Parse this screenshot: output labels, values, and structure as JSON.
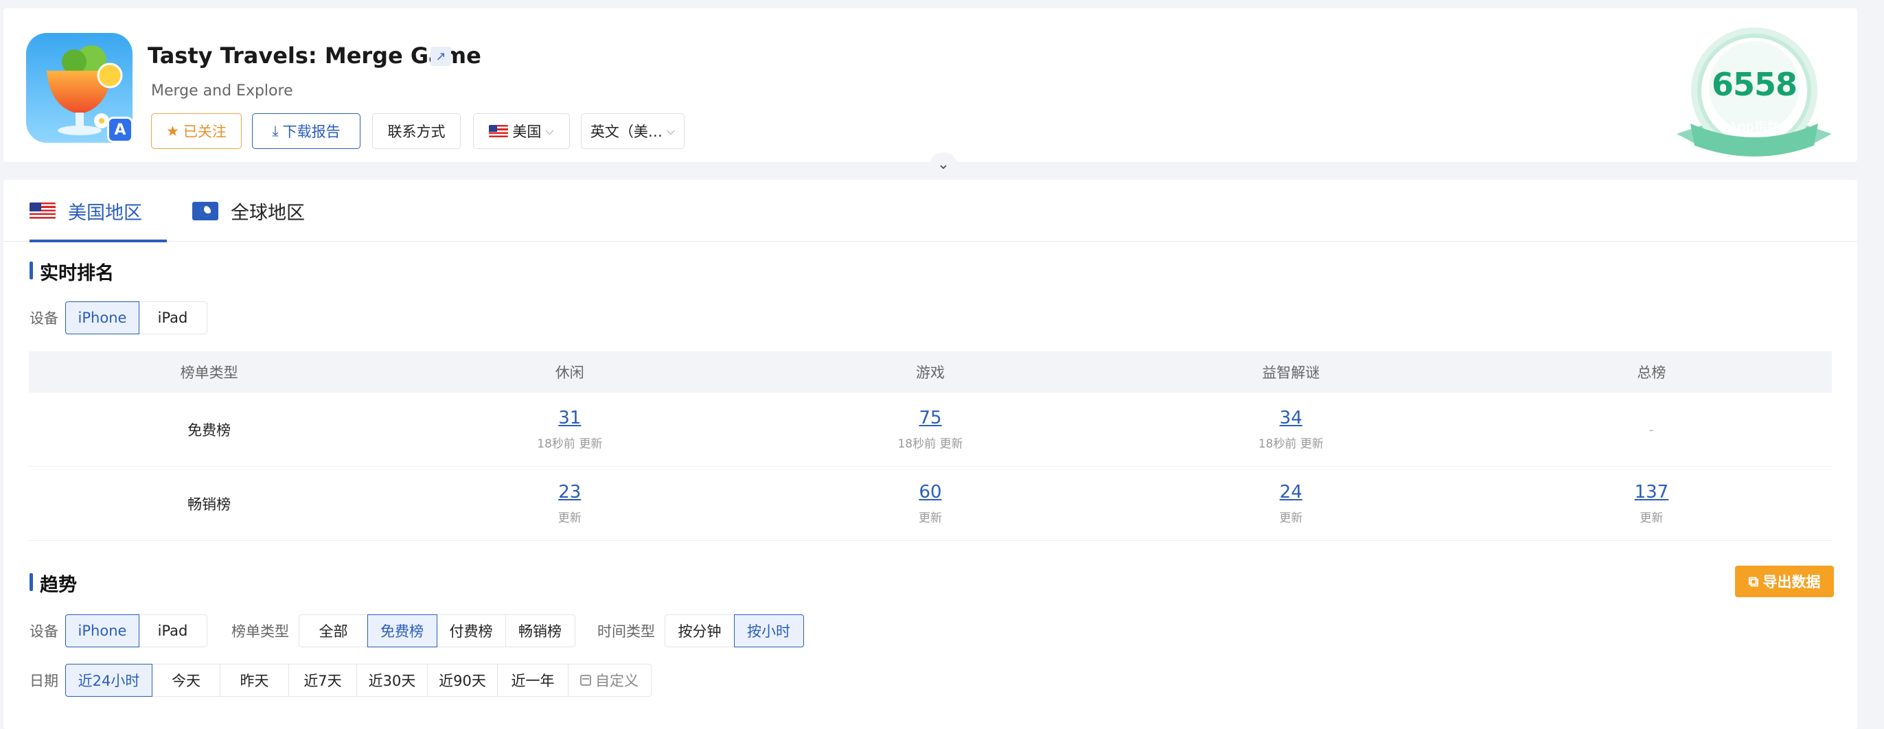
{
  "app": {
    "title": "Tasty Travels: Merge Game",
    "subtitle": "Merge and Explore",
    "link_icon": "↗",
    "store_icon": "A"
  },
  "header": {
    "follow_label": "已关注",
    "follow_icon": "★",
    "download_label": "下载报告",
    "download_icon": "⤓",
    "contact_label": "联系方式",
    "country_label": "美国",
    "language_label": "英文（美…",
    "dropdown_icon": "⌵",
    "collapse_icon": "⌄"
  },
  "score": {
    "value": "6558",
    "label": "App指数"
  },
  "tabs": [
    {
      "label": "美国地区",
      "active": true
    },
    {
      "label": "全球地区",
      "active": false
    }
  ],
  "realtime": {
    "title": "实时排名",
    "device_label": "设备",
    "devices": [
      {
        "label": "iPhone",
        "active": true
      },
      {
        "label": "iPad",
        "active": false
      }
    ],
    "columns": [
      "榜单类型",
      "休闲",
      "游戏",
      "益智解谜",
      "总榜"
    ],
    "rows": [
      {
        "label": "免费榜",
        "cells": [
          {
            "rank": "31",
            "sub": "18秒前 更新"
          },
          {
            "rank": "75",
            "sub": "18秒前 更新"
          },
          {
            "rank": "34",
            "sub": "18秒前 更新"
          },
          {
            "dash": "-"
          }
        ]
      },
      {
        "label": "畅销榜",
        "cells": [
          {
            "rank": "23",
            "sub": "更新"
          },
          {
            "rank": "60",
            "sub": "更新"
          },
          {
            "rank": "24",
            "sub": "更新"
          },
          {
            "rank": "137",
            "sub": "更新"
          }
        ]
      }
    ]
  },
  "trend": {
    "title": "趋势",
    "export_label": "导出数据",
    "export_icon": "⧉",
    "device_label": "设备",
    "devices": [
      {
        "label": "iPhone",
        "active": true
      },
      {
        "label": "iPad",
        "active": false
      }
    ],
    "chart_type_label": "榜单类型",
    "chart_types": [
      {
        "label": "全部",
        "active": false
      },
      {
        "label": "免费榜",
        "active": true
      },
      {
        "label": "付费榜",
        "active": false
      },
      {
        "label": "畅销榜",
        "active": false
      }
    ],
    "time_type_label": "时间类型",
    "time_types": [
      {
        "label": "按分钟",
        "active": false
      },
      {
        "label": "按小时",
        "active": true
      }
    ],
    "date_label": "日期",
    "dates": [
      {
        "label": "近24小时",
        "active": true
      },
      {
        "label": "今天",
        "active": false
      },
      {
        "label": "昨天",
        "active": false
      },
      {
        "label": "近7天",
        "active": false
      },
      {
        "label": "近30天",
        "active": false
      },
      {
        "label": "近90天",
        "active": false
      },
      {
        "label": "近一年",
        "active": false
      }
    ],
    "custom_label": "自定义"
  }
}
